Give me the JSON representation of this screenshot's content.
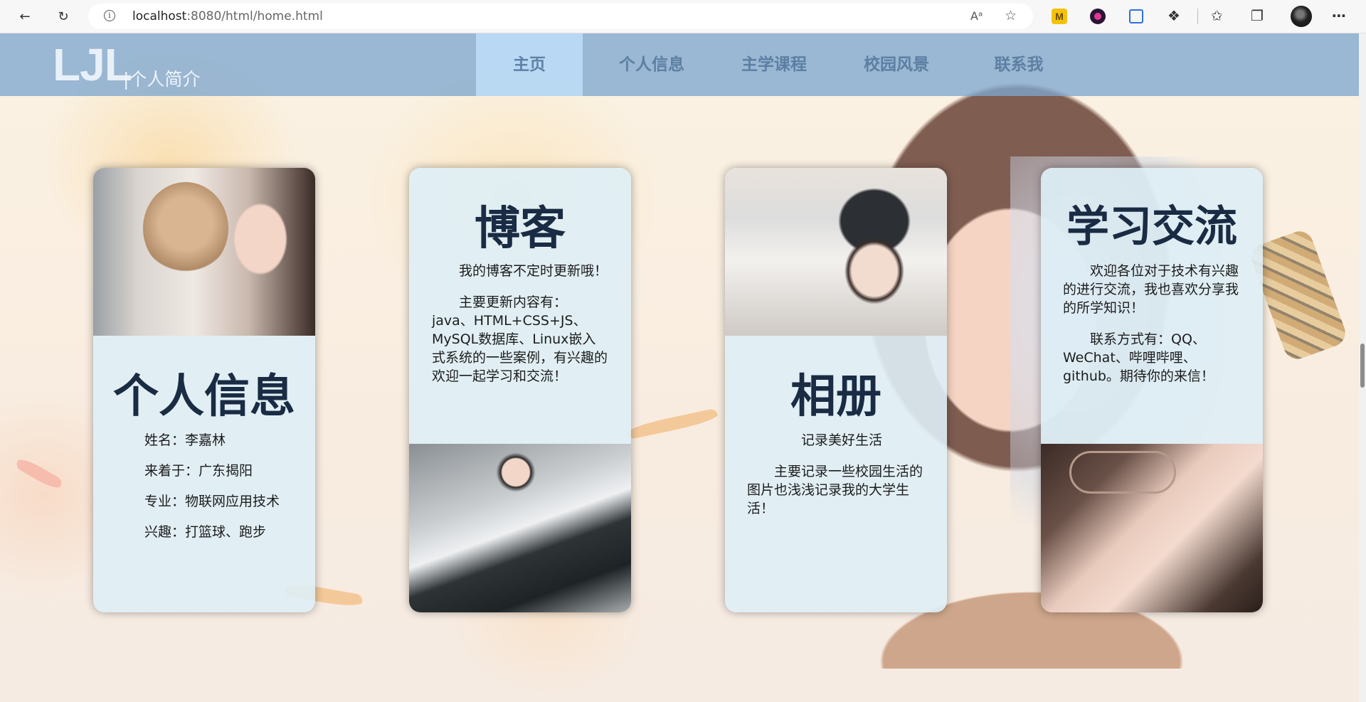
{
  "browser": {
    "url_host": "localhost",
    "url_path": ":8080/html/home.html"
  },
  "header": {
    "logo": "LJL",
    "logo_sub": "|个人简介",
    "nav": [
      {
        "label": "主页",
        "active": true
      },
      {
        "label": "个人信息",
        "active": false
      },
      {
        "label": "主学课程",
        "active": false
      },
      {
        "label": "校园风景",
        "active": false
      },
      {
        "label": "联系我",
        "active": false
      }
    ]
  },
  "cards": {
    "personal": {
      "title": "个人信息",
      "lines": [
        "姓名：李嘉林",
        "来着于：广东揭阳",
        "专业：物联网应用技术",
        "兴趣：打篮球、跑步"
      ]
    },
    "blog": {
      "title": "博客",
      "paragraphs": [
        "我的博客不定时更新哦！",
        "主要更新内容有：java、HTML+CSS+JS、MySQL数据库、Linux嵌入式系统的一些案例，有兴趣的欢迎一起学习和交流！"
      ]
    },
    "album": {
      "title": "相册",
      "paragraphs": [
        "记录美好生活",
        "主要记录一些校园生活的图片也浅浅记录我的大学生活！"
      ]
    },
    "study": {
      "title": "学习交流",
      "paragraphs": [
        "欢迎各位对于技术有兴趣的进行交流，我也喜欢分享我的所学知识！",
        "联系方式有：QQ、WeChat、哔哩哔哩、github。期待你的来信！"
      ]
    }
  },
  "colors": {
    "nav_bg": "#7fa6ce",
    "nav_active": "#bedef8",
    "card_bg": "#deeef6",
    "title_color": "#1a2b44"
  }
}
